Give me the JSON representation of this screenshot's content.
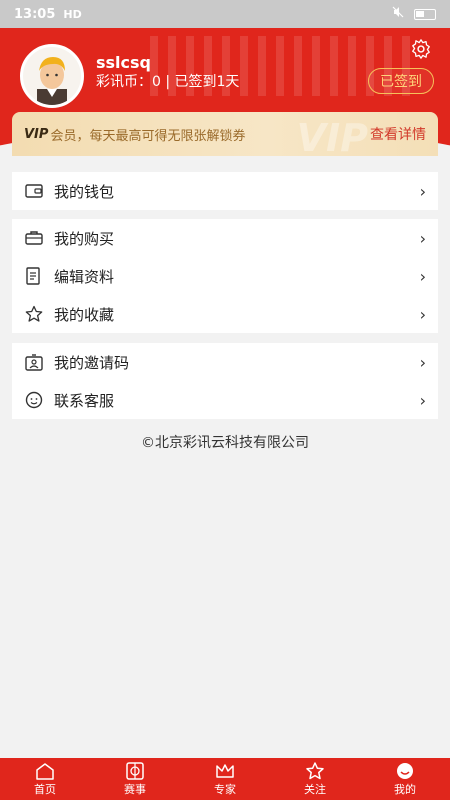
{
  "status_bar": {
    "time": "13:05",
    "network": "HD"
  },
  "profile": {
    "username": "sslcsq",
    "coins_text": "彩讯币：0 | 已签到1天",
    "signed_label": "已签到"
  },
  "vip": {
    "mark": "VIP",
    "text": "会员，每天最高可得无限张解锁券",
    "link": "查看详情",
    "bg_text": "VIP"
  },
  "menu_groups": [
    [
      {
        "label": "我的钱包",
        "icon": "wallet-icon"
      }
    ],
    [
      {
        "label": "我的购买",
        "icon": "briefcase-icon"
      },
      {
        "label": "编辑资料",
        "icon": "edit-profile-icon"
      },
      {
        "label": "我的收藏",
        "icon": "star-icon"
      }
    ],
    [
      {
        "label": "我的邀请码",
        "icon": "invite-code-icon"
      },
      {
        "label": "联系客服",
        "icon": "customer-service-icon"
      }
    ]
  ],
  "copyright": "©北京彩讯云科技有限公司",
  "tabs": [
    {
      "label": "首页",
      "icon": "home-icon"
    },
    {
      "label": "赛事",
      "icon": "match-icon"
    },
    {
      "label": "专家",
      "icon": "crown-icon"
    },
    {
      "label": "关注",
      "icon": "star-icon"
    },
    {
      "label": "我的",
      "icon": "profile-icon"
    }
  ],
  "colors": {
    "brand_red": "#e0261c",
    "gold": "#f6c05a",
    "vip_link": "#d2392a"
  }
}
